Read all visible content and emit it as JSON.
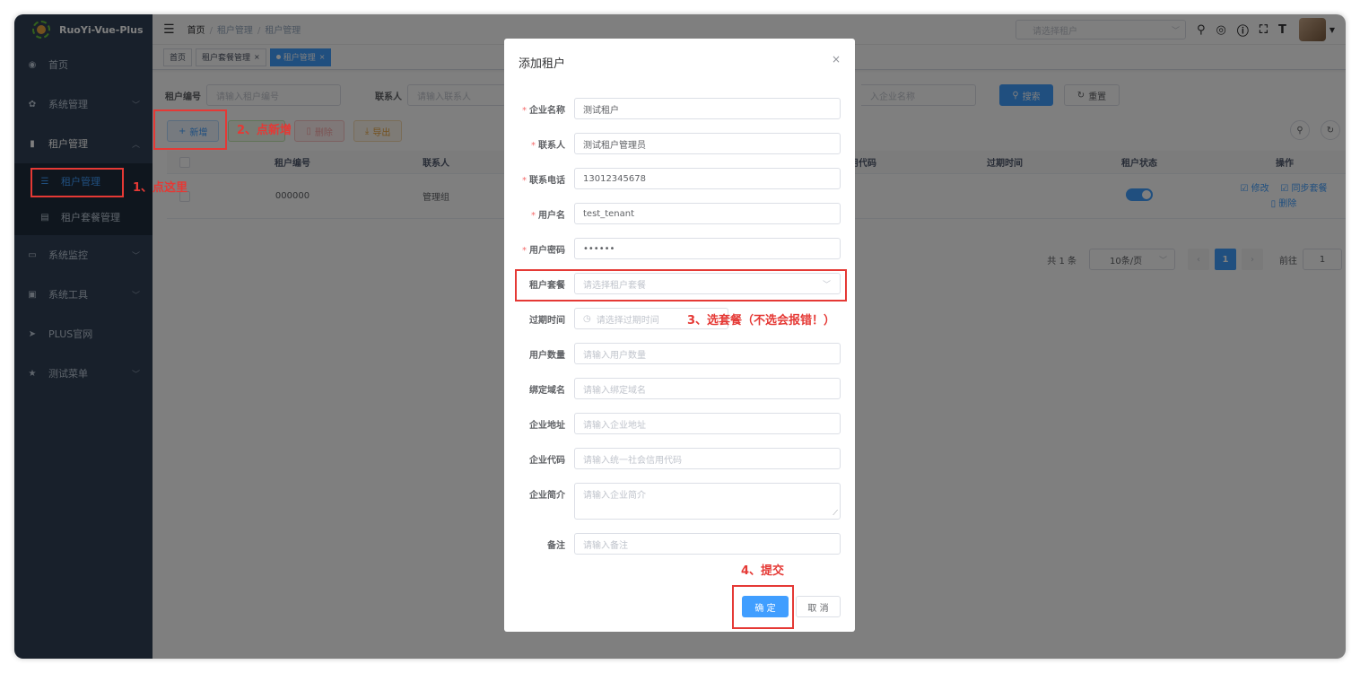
{
  "app": {
    "title": "RuoYi-Vue-Plus"
  },
  "sidebar": {
    "items": [
      {
        "label": "首页",
        "icon": "dashboard-icon"
      },
      {
        "label": "系统管理",
        "icon": "gear-icon"
      },
      {
        "label": "租户管理",
        "icon": "chart-icon"
      },
      {
        "label": "系统监控",
        "icon": "monitor-icon"
      },
      {
        "label": "系统工具",
        "icon": "toolbox-icon"
      },
      {
        "label": "PLUS官网",
        "icon": "send-icon"
      },
      {
        "label": "测试菜单",
        "icon": "star-icon"
      }
    ],
    "sub_items": [
      {
        "label": "租户管理",
        "icon": "list-icon"
      },
      {
        "label": "租户套餐管理",
        "icon": "doc-icon"
      }
    ]
  },
  "navbar": {
    "breadcrumb": [
      "首页",
      "租户管理",
      "租户管理"
    ],
    "tenant_placeholder": "请选择租户"
  },
  "tags": [
    {
      "label": "首页"
    },
    {
      "label": "租户套餐管理"
    },
    {
      "label": "租户管理"
    }
  ],
  "search": {
    "tenant_id_label": "租户编号",
    "tenant_id_placeholder": "请输入租户编号",
    "contact_label": "联系人",
    "contact_placeholder": "请输入联系人",
    "company_placeholder_partial": "入企业名称",
    "search_btn": "搜索",
    "reset_btn": "重置"
  },
  "toolbar": {
    "add": "新增",
    "delete": "删除",
    "export": "导出"
  },
  "table": {
    "headers": {
      "tenant_id": "租户编号",
      "contact": "联系人",
      "credit_code_partial": "用代码",
      "expire": "过期时间",
      "status": "租户状态",
      "ops": "操作"
    },
    "rows": [
      {
        "tenant_id": "000000",
        "contact": "管理组",
        "status_on": true,
        "op_edit": "修改",
        "op_sync": "同步套餐",
        "op_delete": "删除"
      }
    ]
  },
  "pagination": {
    "total": "共 1 条",
    "page_size": "10条/页",
    "current": "1",
    "goto_label": "前往",
    "goto_value": "1"
  },
  "dialog": {
    "title": "添加租户",
    "fields": {
      "company_name": {
        "label": "企业名称",
        "value": "测试租户",
        "required": true
      },
      "contact": {
        "label": "联系人",
        "value": "测试租户管理员",
        "required": true
      },
      "phone": {
        "label": "联系电话",
        "value": "13012345678",
        "required": true
      },
      "username": {
        "label": "用户名",
        "value": "test_tenant",
        "required": true
      },
      "password": {
        "label": "用户密码",
        "value": "••••••",
        "required": true
      },
      "package": {
        "label": "租户套餐",
        "placeholder": "请选择租户套餐"
      },
      "expire": {
        "label": "过期时间",
        "placeholder": "请选择过期时间"
      },
      "user_count": {
        "label": "用户数量",
        "placeholder": "请输入用户数量"
      },
      "domain": {
        "label": "绑定域名",
        "placeholder": "请输入绑定域名"
      },
      "address": {
        "label": "企业地址",
        "placeholder": "请输入企业地址"
      },
      "code": {
        "label": "企业代码",
        "placeholder": "请输入统一社会信用代码"
      },
      "intro": {
        "label": "企业简介",
        "placeholder": "请输入企业简介"
      },
      "remark": {
        "label": "备注",
        "placeholder": "请输入备注"
      }
    },
    "ok": "确 定",
    "cancel": "取 消"
  },
  "annotations": {
    "step1": "1、点这里",
    "step2": "2、点新增",
    "step3": "3、选套餐（不选会报错！）",
    "step4": "4、提交",
    "color": "#e53935"
  },
  "colors": {
    "primary": "#409eff",
    "sidebar_bg": "#304156",
    "danger": "#f56c6c"
  }
}
